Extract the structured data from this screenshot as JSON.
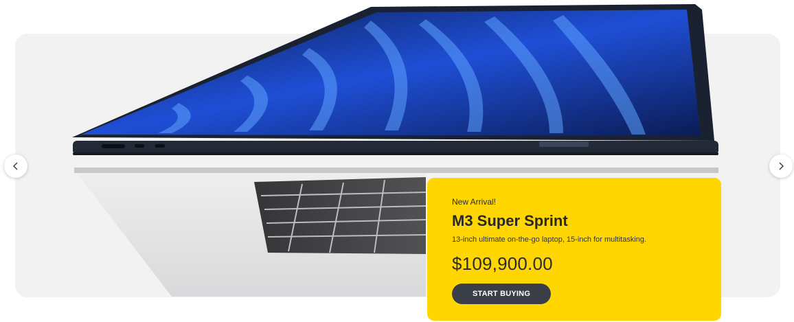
{
  "carousel": {
    "prev_icon": "chevron-left-icon",
    "next_icon": "chevron-right-icon"
  },
  "hero_image": {
    "subject": "laptop"
  },
  "promo": {
    "eyebrow": "New Arrival!",
    "title": "M3 Super Sprint",
    "description": "13-inch ultimate on-the-go laptop, 15-inch for multitasking.",
    "price": "$109,900.00",
    "cta_label": "START BUYING"
  },
  "colors": {
    "card_accent": "#ffd600",
    "cta_background": "#3a3f47",
    "banner_background": "#f2f2f3"
  }
}
